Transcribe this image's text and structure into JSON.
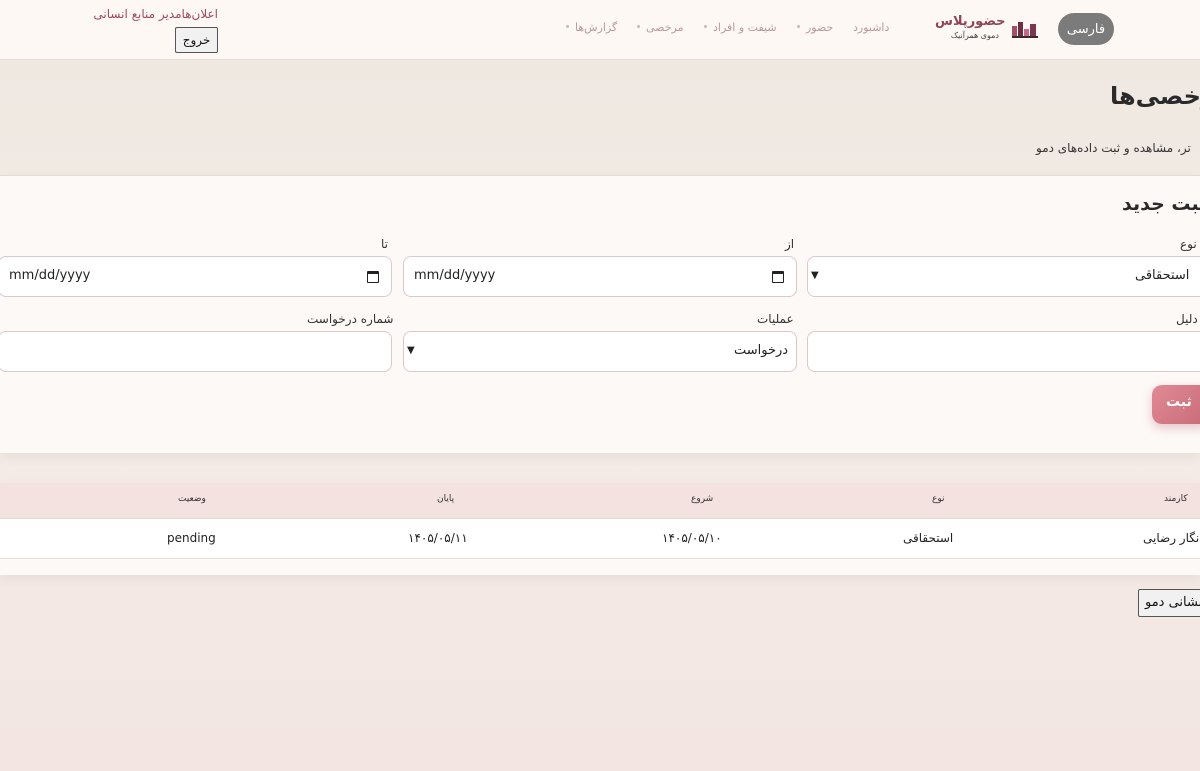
{
  "header": {
    "language_button": "فارسی",
    "brand_name": "حضورپلاس",
    "brand_subtitle": "دموی همرآنیک",
    "nav": [
      "داشبورد",
      "حضور",
      "شیفت و افراد",
      "مرخصی",
      "گزارش‌ها"
    ],
    "hr_title": "اعلان‌هامدیر منابع انسانی",
    "logout_label": "خروج"
  },
  "page": {
    "title": "رخصی‌ها",
    "subtitle": "تر، مشاهده و ثبت داده‌های دمو"
  },
  "form": {
    "title": "ثبت جدید",
    "type_label": "نوع",
    "type_value": "استحقاقی",
    "from_label": "از",
    "from_value": "mm/dd/yyyy",
    "to_label": "تا",
    "to_value": "mm/dd/yyyy",
    "reason_label": "دلیل",
    "reason_value": "",
    "operation_label": "عملیات",
    "operation_value": "درخواست",
    "request_no_label": "شماره درخواست",
    "request_no_value": "",
    "submit_label": "ثبت"
  },
  "table": {
    "headers": {
      "employee": "کارمند",
      "type": "نوع",
      "start": "شروع",
      "end": "پایان",
      "status": "وضعیت"
    },
    "rows": [
      {
        "employee": "نگار رضایی",
        "type": "استحقاقی",
        "start": "۱۴۰۵/۰۵/۱۰",
        "end": "۱۴۰۵/۰۵/۱۱",
        "status": "pending"
      }
    ]
  },
  "reset_label": "بازنشانی دمو",
  "colors": {
    "accent": "#c86a78",
    "brand": "#8e4656"
  }
}
